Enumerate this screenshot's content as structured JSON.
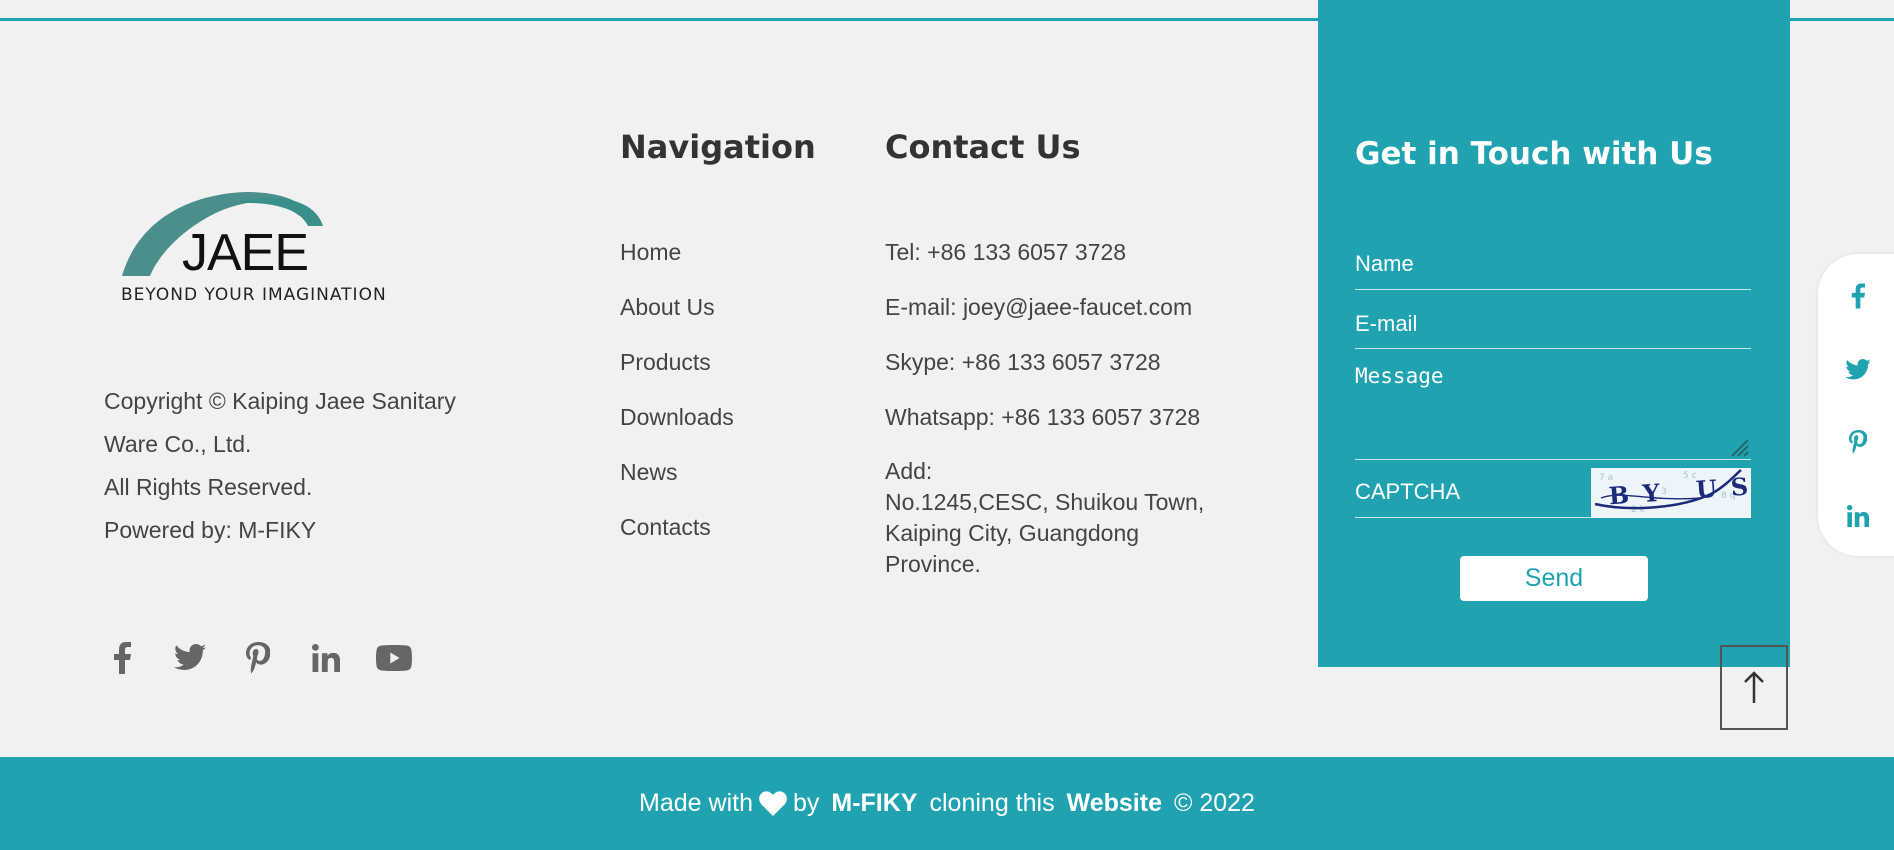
{
  "brand": {
    "logo_name": "JAEE",
    "logo_tagline": "BEYOND YOUR IMAGINATION",
    "accent_color": "#21a2b0"
  },
  "copyright": {
    "lines": [
      "Copyright © Kaiping Jaee Sanitary",
      "Ware Co., Ltd.",
      "All Rights Reserved.",
      "Powered by: M-FIKY"
    ]
  },
  "social_icons": [
    "facebook-icon",
    "twitter-icon",
    "pinterest-icon",
    "linkedin-icon",
    "youtube-icon"
  ],
  "navigation": {
    "title": "Navigation",
    "items": [
      "Home",
      "About Us",
      "Products",
      "Downloads",
      "News",
      "Contacts"
    ]
  },
  "contact": {
    "title": "Contact Us",
    "tel": "Tel: +86 133 6057 3728",
    "email": "E-mail: joey@jaee-faucet.com",
    "skype": "Skype: +86 133 6057 3728",
    "whatsapp": "Whatsapp: +86 133 6057 3728",
    "address_label": "Add:",
    "address_lines": [
      "No.1245,CESC, Shuikou Town,",
      "Kaiping City, Guangdong",
      "Province."
    ]
  },
  "form": {
    "title": "Get in Touch with Us",
    "name_placeholder": "Name",
    "email_placeholder": "E-mail",
    "message_placeholder": "Message",
    "captcha_placeholder": "CAPTCHA",
    "captcha_text": "BY US",
    "send_label": "Send"
  },
  "float_social_icons": [
    "facebook-icon",
    "twitter-icon",
    "pinterest-icon",
    "linkedin-icon"
  ],
  "footer": {
    "made_with": "Made with",
    "by": "by",
    "author": "M-FIKY",
    "cloning": "cloning this",
    "website": "Website",
    "year": "© 2022"
  }
}
